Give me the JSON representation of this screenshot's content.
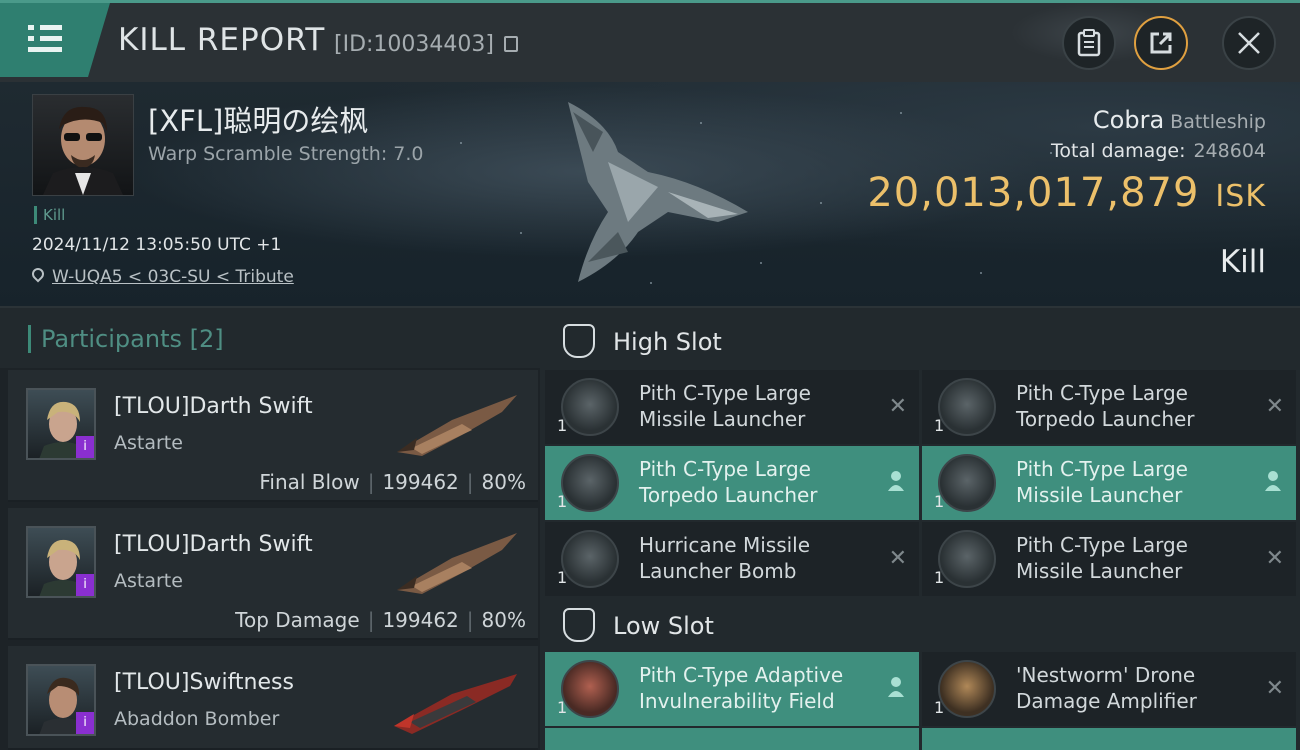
{
  "header": {
    "title": "KILL REPORT",
    "report_id": "[ID:10034403]"
  },
  "victim": {
    "name": "[XFL]聪明の绘枫",
    "warp_scramble": "Warp Scramble Strength: 7.0",
    "kill_tag": "Kill",
    "datetime": "2024/11/12 13:05:50 UTC +1",
    "location": "W-UQA5 < 03C-SU < Tribute",
    "ship_name": "Cobra",
    "ship_class": "Battleship",
    "total_damage_label": "Total damage:",
    "total_damage": "248604",
    "isk_value": "20,013,017,879",
    "isk_unit": "ISK",
    "result": "Kill"
  },
  "participants": {
    "title": "Participants",
    "count": "[2]",
    "items": [
      {
        "name": "[TLOU]Darth Swift",
        "ship": "Astarte",
        "role": "Final Blow",
        "damage": "199462",
        "percent": "80%",
        "badge": "i"
      },
      {
        "name": "[TLOU]Darth Swift",
        "ship": "Astarte",
        "role": "Top Damage",
        "damage": "199462",
        "percent": "80%",
        "badge": "i"
      },
      {
        "name": "[TLOU]Swiftness",
        "ship": "Abaddon Bomber",
        "badge": "i"
      }
    ]
  },
  "high_slot": {
    "title": "High Slot",
    "modules": [
      {
        "name": "Pith C-Type Large Missile Launcher",
        "qty": "1",
        "status": "destroyed"
      },
      {
        "name": "Pith C-Type Large Torpedo Launcher",
        "qty": "1",
        "status": "destroyed"
      },
      {
        "name": "Pith C-Type Large Torpedo Launcher",
        "qty": "1",
        "status": "dropped"
      },
      {
        "name": "Pith C-Type Large Missile Launcher",
        "qty": "1",
        "status": "dropped"
      },
      {
        "name": "Hurricane Missile Launcher Bomb",
        "qty": "1",
        "status": "destroyed"
      },
      {
        "name": "Pith C-Type Large Missile Launcher",
        "qty": "1",
        "status": "destroyed"
      }
    ]
  },
  "low_slot": {
    "title": "Low Slot",
    "modules": [
      {
        "name": "Pith C-Type Adaptive Invulnerability Field",
        "qty": "1",
        "status": "dropped"
      },
      {
        "name": "'Nestworm' Drone Damage Amplifier",
        "qty": "1",
        "status": "destroyed"
      }
    ]
  },
  "icons": {
    "menu": "menu-icon",
    "clipboard": "clipboard-icon",
    "share": "share-icon",
    "close": "close-icon",
    "copy": "copy-icon",
    "pin": "location-pin-icon",
    "slot": "slot-shield-icon",
    "destroyed": "x-icon",
    "dropped": "person-icon"
  },
  "colors": {
    "accent": "#3f8f7e",
    "isk": "#ecc06a",
    "badge": "#8a2fd0",
    "share_ring": "#e0a040"
  }
}
